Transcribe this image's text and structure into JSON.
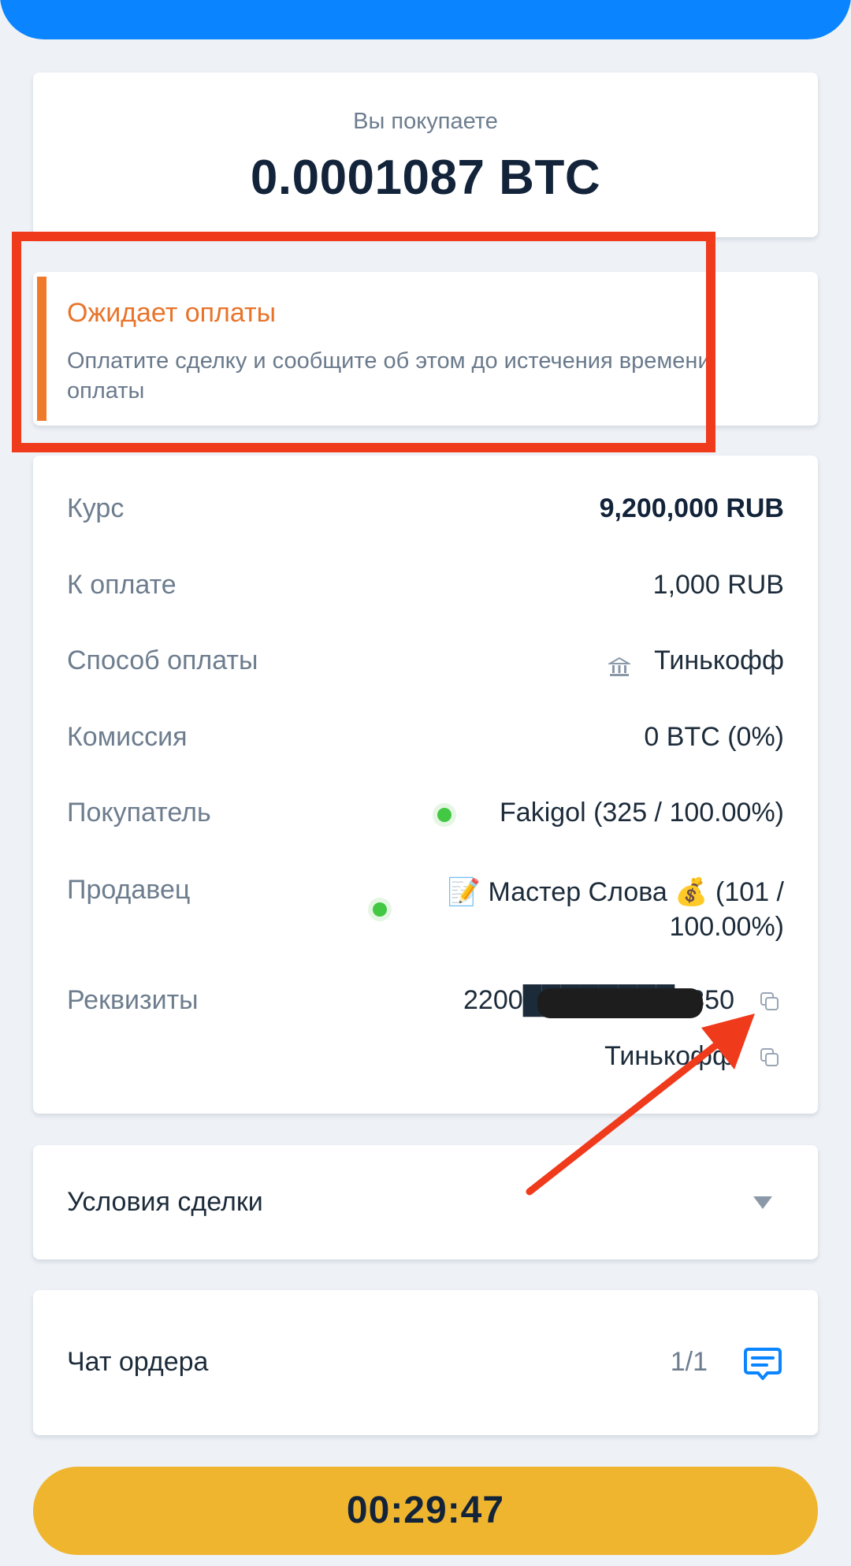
{
  "header": {
    "buy_label": "Вы покупаете",
    "amount": "0.0001087 BTC"
  },
  "status": {
    "title": "Ожидает оплаты",
    "description": "Оплатите сделку и сообщите об этом до истечения времени оплаты"
  },
  "details": {
    "rate_label": "Курс",
    "rate_value": "9,200,000 RUB",
    "to_pay_label": "К оплате",
    "to_pay_value": "1,000 RUB",
    "method_label": "Способ оплаты",
    "method_icon": "bank-icon",
    "method_value": "Тинькофф",
    "fee_label": "Комиссия",
    "fee_value": "0 BTC (0%)",
    "buyer_label": "Покупатель",
    "buyer_value": "Fakigol (325 / 100.00%)",
    "seller_label": "Продавец",
    "seller_value": "📝 Мастер Слова 💰 (101 / 100.00%)",
    "requisites_label": "Реквизиты",
    "requisites_number": "2200████████3350",
    "requisites_bank": "Тинькофф"
  },
  "terms": {
    "label": "Условия сделки"
  },
  "chat": {
    "label": "Чат ордера",
    "count": "1/1"
  },
  "timer": {
    "value": "00:29:47"
  },
  "colors": {
    "accent_blue": "#0a84ff",
    "status_orange": "#f07a2c",
    "timer_yellow": "#efb52f",
    "online_green": "#43c843",
    "annotation_red": "#f03a1c"
  }
}
